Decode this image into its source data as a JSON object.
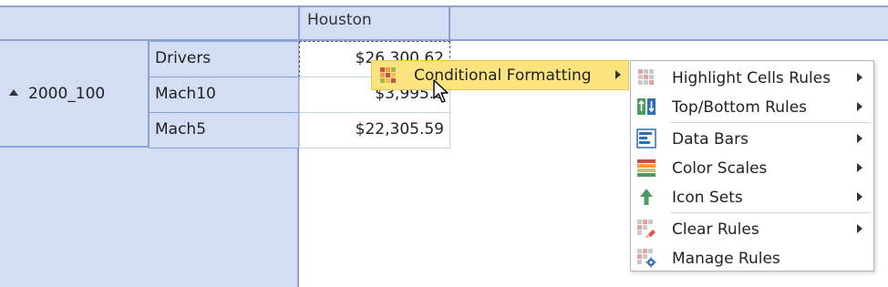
{
  "grid": {
    "column_header": "Houston",
    "group_label": "2000_100",
    "rows": [
      {
        "label": "Drivers",
        "value": "$26,300.62"
      },
      {
        "label": "Mach10",
        "value": "$3,995.0"
      },
      {
        "label": "Mach5",
        "value": "$22,305.59"
      }
    ]
  },
  "context_menu": {
    "item": "Conditional Formatting",
    "submenu": [
      {
        "label": "Highlight Cells Rules",
        "icon": "highlight-cells-icon"
      },
      {
        "label": "Top/Bottom Rules",
        "icon": "top-bottom-icon"
      },
      {
        "label": "Data Bars",
        "icon": "data-bars-icon"
      },
      {
        "label": "Color Scales",
        "icon": "color-scales-icon"
      },
      {
        "label": "Icon Sets",
        "icon": "icon-sets-icon"
      },
      {
        "label": "Clear Rules",
        "icon": "clear-rules-icon"
      },
      {
        "label": "Manage Rules",
        "icon": "manage-rules-icon"
      }
    ]
  },
  "colors": {
    "header_bg": "#d3ddf3",
    "grid_line": "#8ea3d2",
    "highlight": "#fbe47f"
  }
}
